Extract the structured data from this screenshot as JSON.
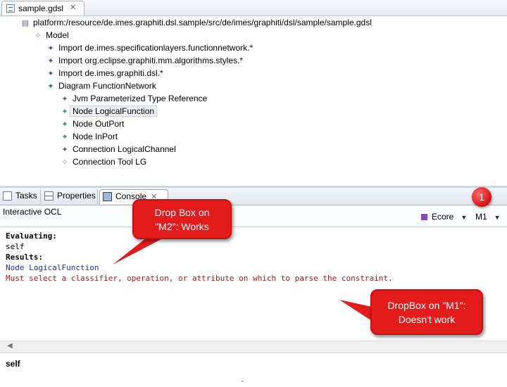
{
  "editor": {
    "tab_label": "sample.gdsl",
    "tab_close": "✕",
    "resource_uri": "platform:/resource/de.imes.graphiti.dsl.sample/src/de/imes/graphiti/dsl/sample/sample.gdsl",
    "tree": {
      "model": "Model",
      "imports": [
        "Import de.imes.specificationlayers.functionnetwork.*",
        "Import org.eclipse.graphiti.mm.algorithms.styles.*",
        "Import de.imes.graphiti.dsl.*"
      ],
      "diagram": "Diagram FunctionNetwork",
      "children": [
        "Jvm Parameterized Type Reference",
        "Node LogicalFunction",
        "Node OutPort",
        "Node InPort",
        "Connection LogicalChannel",
        "Connection Tool LG"
      ]
    }
  },
  "views": {
    "tabs": [
      "Tasks",
      "Properties",
      "Console"
    ],
    "close": "✕"
  },
  "console": {
    "title": "Interactive OCL",
    "ecore_label": "Ecore",
    "m_label": "M1",
    "lines": [
      "Evaluating:",
      "self",
      "Results:",
      "Node LogicalFunction",
      "Must select a classifier, operation, or attribute on which to parse the constraint."
    ],
    "input": "self"
  },
  "annotations": {
    "badge": "1",
    "callout_m2_line1": "Drop Box on",
    "callout_m2_line2": "\"M2\": Works",
    "callout_m1_line1": "DropBox on \"M1\":",
    "callout_m1_line2": "Doesn't work"
  },
  "colors": {
    "callout_red": "#e31b1b",
    "result_blue": "#1d2fb0",
    "error_red": "#b01515",
    "ecore_purple": "#8a4fb4"
  }
}
